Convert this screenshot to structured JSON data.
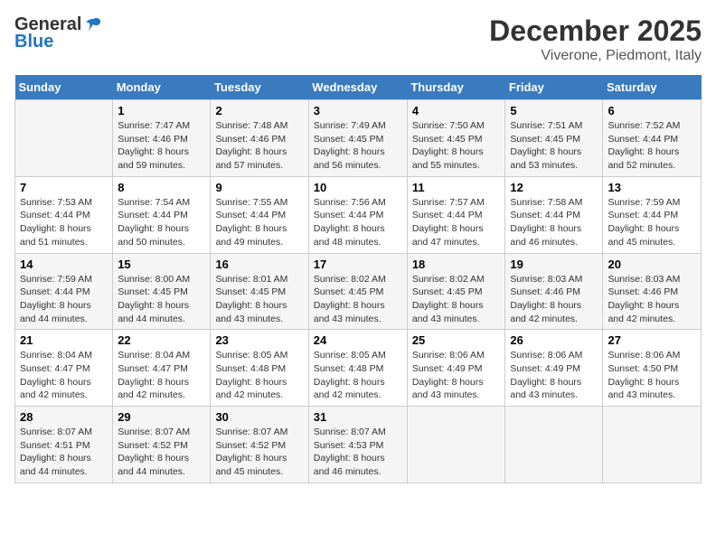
{
  "header": {
    "logo_general": "General",
    "logo_blue": "Blue",
    "title": "December 2025",
    "subtitle": "Viverone, Piedmont, Italy"
  },
  "days_of_week": [
    "Sunday",
    "Monday",
    "Tuesday",
    "Wednesday",
    "Thursday",
    "Friday",
    "Saturday"
  ],
  "weeks": [
    [
      {
        "num": "",
        "sunrise": "",
        "sunset": "",
        "daylight": ""
      },
      {
        "num": "1",
        "sunrise": "Sunrise: 7:47 AM",
        "sunset": "Sunset: 4:46 PM",
        "daylight": "Daylight: 8 hours and 59 minutes."
      },
      {
        "num": "2",
        "sunrise": "Sunrise: 7:48 AM",
        "sunset": "Sunset: 4:46 PM",
        "daylight": "Daylight: 8 hours and 57 minutes."
      },
      {
        "num": "3",
        "sunrise": "Sunrise: 7:49 AM",
        "sunset": "Sunset: 4:45 PM",
        "daylight": "Daylight: 8 hours and 56 minutes."
      },
      {
        "num": "4",
        "sunrise": "Sunrise: 7:50 AM",
        "sunset": "Sunset: 4:45 PM",
        "daylight": "Daylight: 8 hours and 55 minutes."
      },
      {
        "num": "5",
        "sunrise": "Sunrise: 7:51 AM",
        "sunset": "Sunset: 4:45 PM",
        "daylight": "Daylight: 8 hours and 53 minutes."
      },
      {
        "num": "6",
        "sunrise": "Sunrise: 7:52 AM",
        "sunset": "Sunset: 4:44 PM",
        "daylight": "Daylight: 8 hours and 52 minutes."
      }
    ],
    [
      {
        "num": "7",
        "sunrise": "Sunrise: 7:53 AM",
        "sunset": "Sunset: 4:44 PM",
        "daylight": "Daylight: 8 hours and 51 minutes."
      },
      {
        "num": "8",
        "sunrise": "Sunrise: 7:54 AM",
        "sunset": "Sunset: 4:44 PM",
        "daylight": "Daylight: 8 hours and 50 minutes."
      },
      {
        "num": "9",
        "sunrise": "Sunrise: 7:55 AM",
        "sunset": "Sunset: 4:44 PM",
        "daylight": "Daylight: 8 hours and 49 minutes."
      },
      {
        "num": "10",
        "sunrise": "Sunrise: 7:56 AM",
        "sunset": "Sunset: 4:44 PM",
        "daylight": "Daylight: 8 hours and 48 minutes."
      },
      {
        "num": "11",
        "sunrise": "Sunrise: 7:57 AM",
        "sunset": "Sunset: 4:44 PM",
        "daylight": "Daylight: 8 hours and 47 minutes."
      },
      {
        "num": "12",
        "sunrise": "Sunrise: 7:58 AM",
        "sunset": "Sunset: 4:44 PM",
        "daylight": "Daylight: 8 hours and 46 minutes."
      },
      {
        "num": "13",
        "sunrise": "Sunrise: 7:59 AM",
        "sunset": "Sunset: 4:44 PM",
        "daylight": "Daylight: 8 hours and 45 minutes."
      }
    ],
    [
      {
        "num": "14",
        "sunrise": "Sunrise: 7:59 AM",
        "sunset": "Sunset: 4:44 PM",
        "daylight": "Daylight: 8 hours and 44 minutes."
      },
      {
        "num": "15",
        "sunrise": "Sunrise: 8:00 AM",
        "sunset": "Sunset: 4:45 PM",
        "daylight": "Daylight: 8 hours and 44 minutes."
      },
      {
        "num": "16",
        "sunrise": "Sunrise: 8:01 AM",
        "sunset": "Sunset: 4:45 PM",
        "daylight": "Daylight: 8 hours and 43 minutes."
      },
      {
        "num": "17",
        "sunrise": "Sunrise: 8:02 AM",
        "sunset": "Sunset: 4:45 PM",
        "daylight": "Daylight: 8 hours and 43 minutes."
      },
      {
        "num": "18",
        "sunrise": "Sunrise: 8:02 AM",
        "sunset": "Sunset: 4:45 PM",
        "daylight": "Daylight: 8 hours and 43 minutes."
      },
      {
        "num": "19",
        "sunrise": "Sunrise: 8:03 AM",
        "sunset": "Sunset: 4:46 PM",
        "daylight": "Daylight: 8 hours and 42 minutes."
      },
      {
        "num": "20",
        "sunrise": "Sunrise: 8:03 AM",
        "sunset": "Sunset: 4:46 PM",
        "daylight": "Daylight: 8 hours and 42 minutes."
      }
    ],
    [
      {
        "num": "21",
        "sunrise": "Sunrise: 8:04 AM",
        "sunset": "Sunset: 4:47 PM",
        "daylight": "Daylight: 8 hours and 42 minutes."
      },
      {
        "num": "22",
        "sunrise": "Sunrise: 8:04 AM",
        "sunset": "Sunset: 4:47 PM",
        "daylight": "Daylight: 8 hours and 42 minutes."
      },
      {
        "num": "23",
        "sunrise": "Sunrise: 8:05 AM",
        "sunset": "Sunset: 4:48 PM",
        "daylight": "Daylight: 8 hours and 42 minutes."
      },
      {
        "num": "24",
        "sunrise": "Sunrise: 8:05 AM",
        "sunset": "Sunset: 4:48 PM",
        "daylight": "Daylight: 8 hours and 42 minutes."
      },
      {
        "num": "25",
        "sunrise": "Sunrise: 8:06 AM",
        "sunset": "Sunset: 4:49 PM",
        "daylight": "Daylight: 8 hours and 43 minutes."
      },
      {
        "num": "26",
        "sunrise": "Sunrise: 8:06 AM",
        "sunset": "Sunset: 4:49 PM",
        "daylight": "Daylight: 8 hours and 43 minutes."
      },
      {
        "num": "27",
        "sunrise": "Sunrise: 8:06 AM",
        "sunset": "Sunset: 4:50 PM",
        "daylight": "Daylight: 8 hours and 43 minutes."
      }
    ],
    [
      {
        "num": "28",
        "sunrise": "Sunrise: 8:07 AM",
        "sunset": "Sunset: 4:51 PM",
        "daylight": "Daylight: 8 hours and 44 minutes."
      },
      {
        "num": "29",
        "sunrise": "Sunrise: 8:07 AM",
        "sunset": "Sunset: 4:52 PM",
        "daylight": "Daylight: 8 hours and 44 minutes."
      },
      {
        "num": "30",
        "sunrise": "Sunrise: 8:07 AM",
        "sunset": "Sunset: 4:52 PM",
        "daylight": "Daylight: 8 hours and 45 minutes."
      },
      {
        "num": "31",
        "sunrise": "Sunrise: 8:07 AM",
        "sunset": "Sunset: 4:53 PM",
        "daylight": "Daylight: 8 hours and 46 minutes."
      },
      {
        "num": "",
        "sunrise": "",
        "sunset": "",
        "daylight": ""
      },
      {
        "num": "",
        "sunrise": "",
        "sunset": "",
        "daylight": ""
      },
      {
        "num": "",
        "sunrise": "",
        "sunset": "",
        "daylight": ""
      }
    ]
  ]
}
